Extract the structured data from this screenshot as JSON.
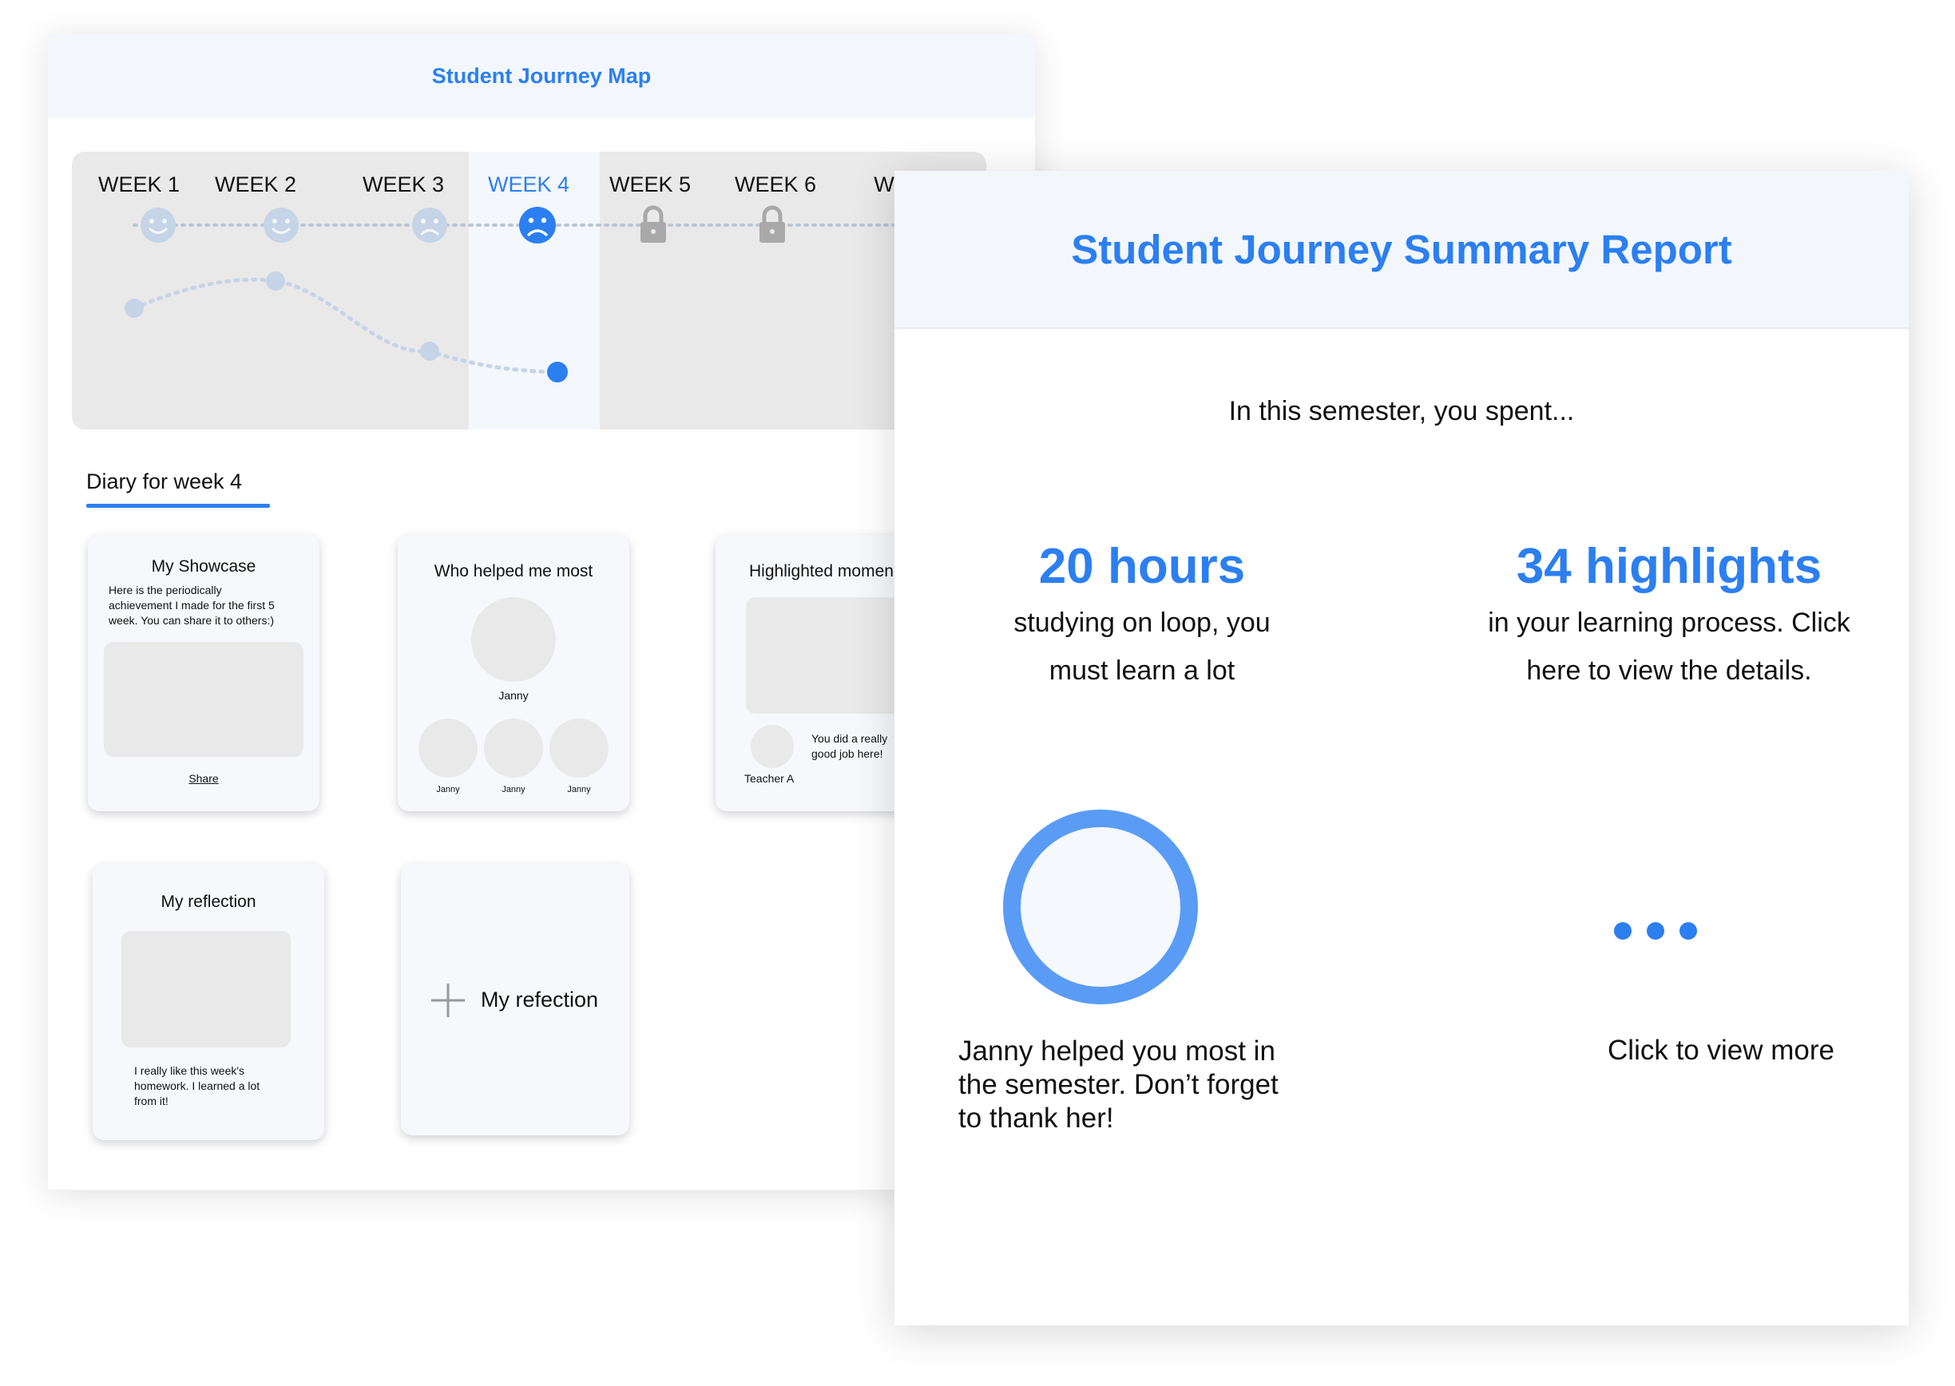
{
  "journey_map": {
    "title": "Student Journey Map",
    "weeks": [
      {
        "label": "WEEK 1",
        "mood": "happy-face-icon",
        "state": "done"
      },
      {
        "label": "WEEK 2",
        "mood": "happy-face-icon",
        "state": "done"
      },
      {
        "label": "WEEK 3",
        "mood": "sad-face-icon",
        "state": "done"
      },
      {
        "label": "WEEK 4",
        "mood": "sad-face-icon",
        "state": "active"
      },
      {
        "label": "WEEK 5",
        "mood": "lock-icon",
        "state": "locked"
      },
      {
        "label": "WEEK 6",
        "mood": "lock-icon",
        "state": "locked"
      },
      {
        "label": "WE",
        "mood": "lock-icon",
        "state": "locked"
      }
    ],
    "diary_tab": "Diary for week 4",
    "cards": {
      "showcase": {
        "title": "My Showcase",
        "desc_line1": "Here is the periodically",
        "desc_line2": "achievement I made for the first 5",
        "desc_line3": "week. You can share it to others:)",
        "share": "Share"
      },
      "helpers": {
        "title": "Who helped me most",
        "main_name": "Janny",
        "names": [
          "Janny",
          "Janny",
          "Janny"
        ]
      },
      "highlight": {
        "title": "Highlighted momen",
        "comment_line1": "You did a really",
        "comment_line2": "good job here!",
        "commenter": "Teacher A"
      },
      "reflection": {
        "title": "My reflection",
        "text_line1": "I really like this week's",
        "text_line2": "homework. I learned a lot",
        "text_line3": "from it!"
      },
      "add_reflection": {
        "label": "My refection"
      }
    }
  },
  "summary": {
    "title": "Student Journey Summary Report",
    "intro": "In this semester, you spent...",
    "hours_value": "20 hours",
    "hours_desc_line1": "studying on loop, you",
    "hours_desc_line2": "must learn a lot",
    "highlights_value": "34 highlights",
    "highlights_desc_line1": "in your learning process. Click",
    "highlights_desc_line2": "here to view the details.",
    "helper_line1": "Janny helped you most in",
    "helper_line2": "the semester. Don’t forget",
    "helper_line3": "to thank her!",
    "more": "Click to view more"
  },
  "colors": {
    "accent": "#2c7ff0",
    "muted_icon": "#c6d4e8",
    "lock": "#a9a9a9",
    "panel_header": "#f3f7fc",
    "placeholder": "#e9e9e9"
  }
}
